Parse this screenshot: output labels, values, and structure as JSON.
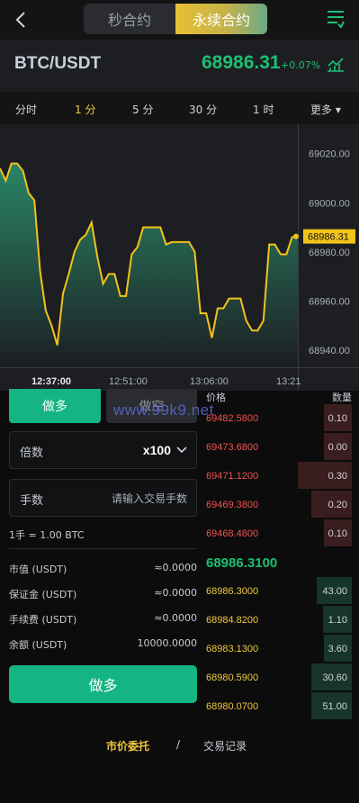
{
  "nav": {
    "tabs": [
      "秒合约",
      "永续合约"
    ],
    "active_tab": 1
  },
  "header": {
    "pair": "BTC/USDT",
    "price": "68986.31",
    "change": "+0.07%"
  },
  "intervals": {
    "items": [
      "分时",
      "1 分",
      "5 分",
      "30 分",
      "1 时",
      "更多 ▾"
    ],
    "active": 1
  },
  "chart_data": {
    "type": "area",
    "title": "",
    "xlabel": "",
    "ylabel": "",
    "ylim": [
      68933,
      69032
    ],
    "y_ticks": [
      "69020.00",
      "69000.00",
      "68980.00",
      "68960.00",
      "68940.00"
    ],
    "y_tick_values": [
      69020,
      69000,
      68980,
      68960,
      68940
    ],
    "x_ticks": [
      "12:37:00",
      "12:51:00",
      "13:06:00",
      "13:21"
    ],
    "current_price_label": "68986.31",
    "current_price": 68986.31,
    "colors": {
      "line": "#f2c318",
      "fill_top": "#2a8a6a",
      "fill_bottom": "#1d1e22"
    },
    "series": [
      {
        "values": [
          69014,
          69009,
          69016,
          69016,
          69013,
          69004,
          69001,
          68972,
          68956,
          68950,
          68942,
          68963,
          68971,
          68980,
          68985,
          68987,
          68992,
          68978,
          68967,
          68971,
          68971,
          68962,
          68962,
          68979,
          68982,
          68990,
          68990,
          68990,
          68990,
          68983,
          68984,
          68984,
          68984,
          68984,
          68980,
          68955,
          68955,
          68945,
          68957,
          68957,
          68961,
          68961,
          68961,
          68952,
          68948,
          68948,
          68952,
          68983,
          68983,
          68979,
          68979,
          68986,
          68986
        ]
      }
    ]
  },
  "form": {
    "buy_tab": "做多",
    "sell_tab": "做空",
    "leverage_label": "倍数",
    "leverage_value": "x100",
    "qty_label": "手数",
    "qty_placeholder": "请输入交易手数",
    "lot_info": "1手 = 1.00 BTC",
    "rows": [
      {
        "k": "市值 (USDT)",
        "v": "≈0.0000"
      },
      {
        "k": "保证金 (USDT)",
        "v": "≈0.0000"
      },
      {
        "k": "手续费 (USDT)",
        "v": "≈0.0000"
      },
      {
        "k": "余额 (USDT)",
        "v": "10000.0000"
      }
    ],
    "submit": "做多"
  },
  "watermark": "www.99k9.net",
  "orderbook": {
    "price_header": "价格",
    "qty_header": "数量",
    "asks": [
      {
        "p": "69482.5800",
        "q": "0.10",
        "depth": 0.19
      },
      {
        "p": "69473.6800",
        "q": "0.00",
        "depth": 0.19
      },
      {
        "p": "69471.1200",
        "q": "0.30",
        "depth": 0.37
      },
      {
        "p": "69469.3800",
        "q": "0.20",
        "depth": 0.28
      },
      {
        "p": "69468.4800",
        "q": "0.10",
        "depth": 0.19
      }
    ],
    "mid_price": "68986.3100",
    "bids": [
      {
        "p": "68986.3000",
        "q": "43.00",
        "depth": 0.24
      },
      {
        "p": "68984.8200",
        "q": "1.10",
        "depth": 0.2
      },
      {
        "p": "68983.1300",
        "q": "3.60",
        "depth": 0.19
      },
      {
        "p": "68980.5900",
        "q": "30.60",
        "depth": 0.28
      },
      {
        "p": "68980.0700",
        "q": "51.00",
        "depth": 0.28
      }
    ],
    "ask_color": "#f0524e",
    "bid_color": "#f0c93b"
  },
  "footer": {
    "tab_active": "市价委托",
    "separator": "/",
    "tab_other": "交易记录"
  }
}
